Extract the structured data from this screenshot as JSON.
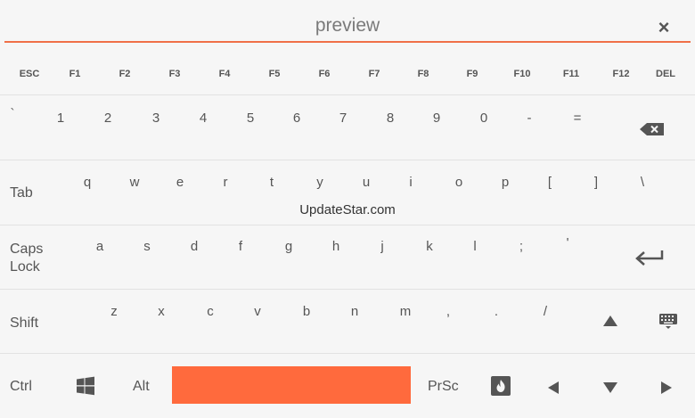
{
  "preview": {
    "text": "preview",
    "close_glyph": "×"
  },
  "watermark": "UpdateStar.com",
  "colors": {
    "accent": "#ff6a3d",
    "underline": "#f07048",
    "background": "#f6f6f6"
  },
  "function_row": [
    "ESC",
    "F1",
    "F2",
    "F3",
    "F4",
    "F5",
    "F6",
    "F7",
    "F8",
    "F9",
    "F10",
    "F11",
    "F12",
    "DEL"
  ],
  "number_row": [
    "`",
    "1",
    "2",
    "3",
    "4",
    "5",
    "6",
    "7",
    "8",
    "9",
    "0",
    "-",
    "="
  ],
  "tab_row": {
    "label": "Tab",
    "keys": [
      "q",
      "w",
      "e",
      "r",
      "t",
      "y",
      "u",
      "i",
      "o",
      "p",
      "[",
      "]",
      "\\"
    ]
  },
  "caps_row": {
    "label_line1": "Caps",
    "label_line2": "Lock",
    "keys": [
      "a",
      "s",
      "d",
      "f",
      "g",
      "h",
      "j",
      "k",
      "l",
      ";",
      "'"
    ]
  },
  "shift_row": {
    "label": "Shift",
    "keys": [
      "z",
      "x",
      "c",
      "v",
      "b",
      "n",
      "m",
      ",",
      ".",
      "/"
    ]
  },
  "bottom_row": {
    "ctrl": "Ctrl",
    "alt": "Alt",
    "prsc": "PrSc"
  },
  "icons": {
    "backspace": "backspace-icon",
    "enter": "enter-icon",
    "up": "arrow-up-icon",
    "keyboard": "keyboard-icon",
    "windows": "windows-icon",
    "fire": "fire-icon",
    "left": "arrow-left-icon",
    "down": "arrow-down-icon",
    "right": "arrow-right-icon"
  }
}
